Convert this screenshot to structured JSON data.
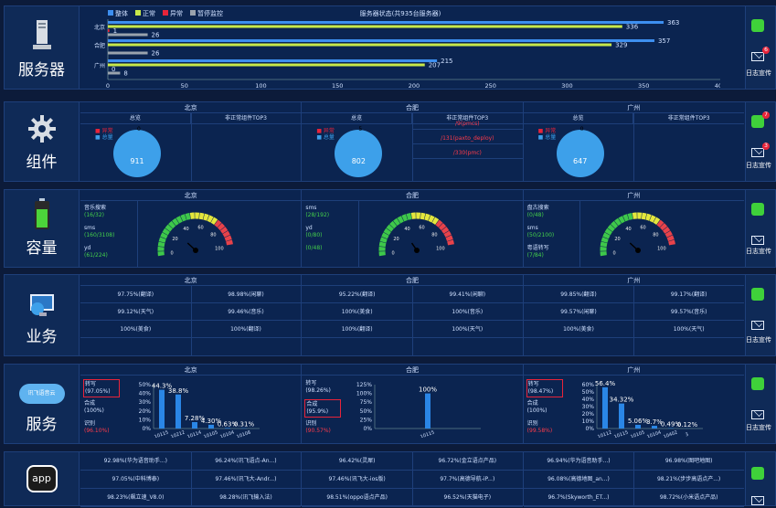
{
  "sections": {
    "servers": {
      "name": "服务器",
      "alerts": "6"
    },
    "components": {
      "name": "组件",
      "alerts_green": "7",
      "alerts_mail": "3"
    },
    "capacity": {
      "name": "容量"
    },
    "business": {
      "name": "业务"
    },
    "service": {
      "name": "服务"
    },
    "app": {
      "name": "app",
      "logo": "app"
    }
  },
  "side_label": "日志宣传",
  "cloud_logo": "讯飞语音云",
  "cities": [
    "北京",
    "合肥",
    "广州"
  ],
  "server_chart": {
    "title": "服务器状态(共935台服务器)",
    "legend": [
      "整体",
      "正常",
      "异常",
      "暂停监控"
    ]
  },
  "chart_data": {
    "type": "bar",
    "orientation": "horizontal",
    "title": "服务器状态(共935台服务器)",
    "categories": [
      "北京",
      "合肥",
      "广州"
    ],
    "series": [
      {
        "name": "整体",
        "values": [
          363,
          357,
          215
        ],
        "color": "#3d8ff0"
      },
      {
        "name": "正常",
        "values": [
          336,
          329,
          207
        ],
        "color": "#c8e84a"
      },
      {
        "name": "异常",
        "values": [
          1,
          0,
          0
        ],
        "color": "#e8243a"
      },
      {
        "name": "暂停监控",
        "values": [
          26,
          26,
          8
        ],
        "color": "#9aa3ad"
      }
    ],
    "xlim": [
      0,
      400
    ],
    "xticks": [
      "0",
      "50",
      "100",
      "150",
      "200",
      "250",
      "300",
      "350",
      "400"
    ],
    "value_labels": {
      "北京": [
        "363",
        "336",
        "1",
        "26"
      ],
      "合肥": [
        "357",
        "329",
        "",
        "26"
      ],
      "广州": [
        "215",
        "207",
        "0",
        "8"
      ]
    }
  },
  "components": {
    "headers": [
      "总览",
      "非正常组件TOP3"
    ],
    "legend": [
      "异常",
      "总量"
    ],
    "cities": [
      {
        "total": "911",
        "abnormal": "0",
        "top3": []
      },
      {
        "total": "802",
        "abnormal": "5",
        "top3": [
          "/9(pmcs)",
          "/131(paxto_deploy)",
          "/330(pmc)"
        ]
      },
      {
        "total": "647",
        "abnormal": "0",
        "top3": []
      }
    ]
  },
  "capacity": {
    "cities": [
      {
        "items": [
          {
            "name": "音乐搜索",
            "val": "(16/32)"
          },
          {
            "name": "sms",
            "val": "(160/3108)"
          },
          {
            "name": "yd",
            "val": "(61/224)"
          }
        ],
        "needle": 0.2
      },
      {
        "items": [
          {
            "name": "sms",
            "val": "(28/192)"
          },
          {
            "name": "yd",
            "val": "(0/80)"
          },
          {
            "name": "",
            "val": "(0/48)"
          }
        ],
        "needle": 0.15
      },
      {
        "items": [
          {
            "name": "盘古搜索",
            "val": "(0/48)"
          },
          {
            "name": "sms",
            "val": "(50/2100)"
          },
          {
            "name": "粤语转写",
            "val": "(7/84)"
          }
        ],
        "needle": 0.2
      }
    ],
    "gauge_labels": [
      "0",
      "20",
      "40",
      "60",
      "80",
      "100"
    ]
  },
  "business": {
    "cities": [
      [
        [
          "97.75%(翻译)",
          "98.98%(闲聊)"
        ],
        [
          "99.12%(天气)",
          "99.46%(音乐)"
        ],
        [
          "100%(美食)",
          "100%(翻译)"
        ]
      ],
      [
        [
          "95.22%(翻译)",
          "99.41%(闲聊)"
        ],
        [
          "100%(美食)",
          "100%(音乐)"
        ],
        [
          "100%(翻译)",
          "100%(天气)"
        ]
      ],
      [
        [
          "99.85%(翻译)",
          "99.17%(翻译)"
        ],
        [
          "99.57%(闲聊)",
          "99.57%(音乐)"
        ],
        [
          "100%(美食)",
          "100%(天气)"
        ]
      ]
    ]
  },
  "service": {
    "cities": [
      {
        "items": [
          {
            "name": "转写",
            "val": "(97.05%)",
            "boxed": true
          },
          {
            "name": "合成",
            "val": "(100%)",
            "boxed": false
          },
          {
            "name": "识别",
            "val": "(96.10%)",
            "boxed": false,
            "red": true
          }
        ],
        "yticks": [
          "50%",
          "40%",
          "30%",
          "20%",
          "10%",
          "0%"
        ],
        "bars": [
          {
            "v": 0.883,
            "label": "44.3%"
          },
          {
            "v": 0.776,
            "label": "38.8%"
          },
          {
            "v": 0.146,
            "label": "7.28%"
          },
          {
            "v": 0.086,
            "label": "4.30%"
          },
          {
            "v": 0.013,
            "label": "0.63%"
          },
          {
            "v": 0.006,
            "label": "0.31%"
          }
        ],
        "xlabels": [
          "10115",
          "10212",
          "10114",
          "10105",
          "10104",
          "10108"
        ]
      },
      {
        "items": [
          {
            "name": "转写",
            "val": "(98.26%)",
            "boxed": false
          },
          {
            "name": "合成",
            "val": "(95.9%)",
            "boxed": true
          },
          {
            "name": "识别",
            "val": "(90.57%)",
            "boxed": false,
            "red": true
          }
        ],
        "yticks": [
          "125%",
          "100%",
          "75%",
          "50%",
          "25%",
          "0%"
        ],
        "bars": [
          {
            "v": 0.8,
            "label": "100%"
          }
        ],
        "xlabels": [
          "10115"
        ]
      },
      {
        "items": [
          {
            "name": "转写",
            "val": "(98.47%)",
            "boxed": true
          },
          {
            "name": "合成",
            "val": "(100%)",
            "boxed": false
          },
          {
            "name": "识别",
            "val": "(99.58%)",
            "boxed": false,
            "red": true
          }
        ],
        "yticks": [
          "60%",
          "50%",
          "40%",
          "30%",
          "20%",
          "10%",
          "0%"
        ],
        "bars": [
          {
            "v": 0.94,
            "label": "56.4%"
          },
          {
            "v": 0.57,
            "label": "34.32%"
          },
          {
            "v": 0.084,
            "label": "5.06%"
          },
          {
            "v": 0.062,
            "label": "3.7%"
          },
          {
            "v": 0.008,
            "label": "0.49%"
          },
          {
            "v": 0.002,
            "label": "0.12%"
          }
        ],
        "xlabels": [
          "10112",
          "10115",
          "10105",
          "10104",
          "10402",
          "3"
        ]
      }
    ]
  },
  "app": {
    "cities": [
      [
        [
          "92.98%(华为语音助手...)",
          "96.24%(讯飞语点-An...)"
        ],
        [
          "97.05%(中科博泰)",
          "97.46%(讯飞大-Andr...)"
        ],
        [
          "98.23%(飙立速_V8.0)",
          "98.28%(讯飞输入法)"
        ]
      ],
      [
        [
          "96.42%(灵犀)",
          "96.72%(金立语点产品)"
        ],
        [
          "97.46%(讯飞大-ios版)",
          "97.7%(高德导航-iP...)"
        ],
        [
          "98.51%(oppo语点产品)",
          "96.52%(天猫电子)"
        ]
      ],
      [
        [
          "96.94%(华为语音助手...)",
          "96.98%(图吧地图)"
        ],
        [
          "96.08%(高德地图_an...)",
          "98.21%(步步高语点产...)"
        ],
        [
          "96.7%(Skyworth_ET...)",
          "98.72%(小米语点产品)"
        ]
      ]
    ]
  }
}
